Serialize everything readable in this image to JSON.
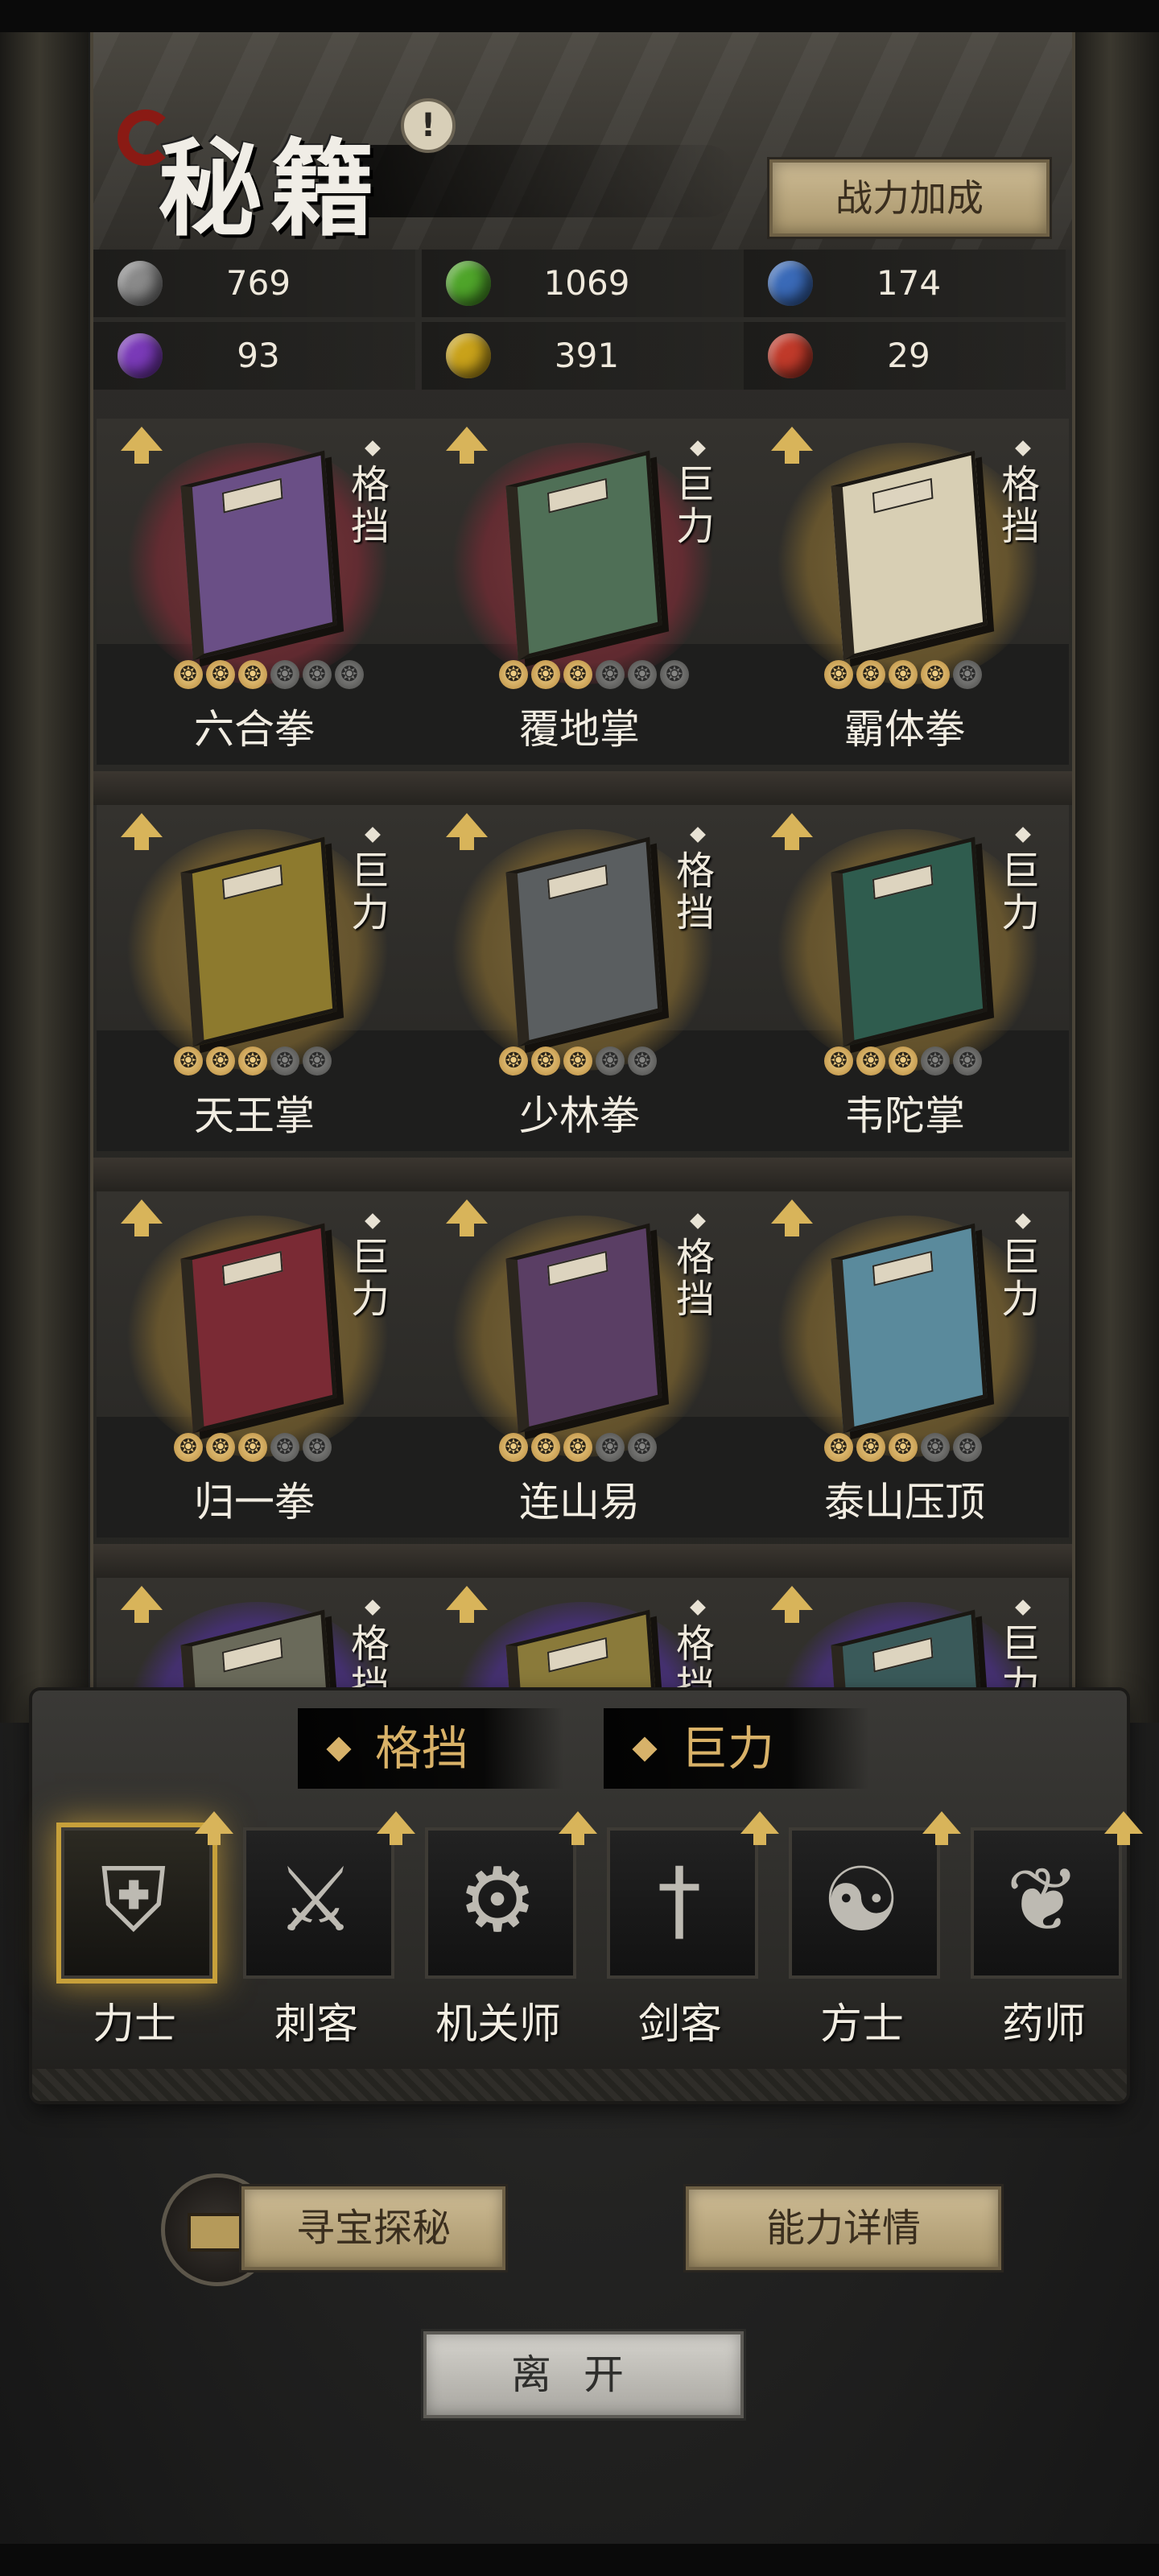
{
  "header": {
    "title": "秘籍",
    "info_icon": "!",
    "bonus_button": "战力加成"
  },
  "resources": [
    {
      "icon": "gray-orb-icon",
      "color": "#8a8a8a",
      "value": "769"
    },
    {
      "icon": "green-orb-icon",
      "color": "#4fa52a",
      "value": "1069"
    },
    {
      "icon": "blue-orb-icon",
      "color": "#3a6ab8",
      "value": "174"
    },
    {
      "icon": "purple-orb-icon",
      "color": "#7a3ab8",
      "value": "93"
    },
    {
      "icon": "yellow-orb-icon",
      "color": "#c9a21a",
      "value": "391"
    },
    {
      "icon": "red-orb-icon",
      "color": "#c03a2a",
      "value": "29"
    }
  ],
  "books": [
    {
      "name": "六合拳",
      "type": "格挡",
      "halo": "red",
      "cover": "#6a4f86",
      "stars_on": 3,
      "stars_total": 6
    },
    {
      "name": "覆地掌",
      "type": "巨力",
      "halo": "red",
      "cover": "#4f6f56",
      "stars_on": 3,
      "stars_total": 6
    },
    {
      "name": "霸体拳",
      "type": "格挡",
      "halo": "gold",
      "cover": "#d8cfb4",
      "stars_on": 4,
      "stars_total": 5
    },
    {
      "name": "天王掌",
      "type": "巨力",
      "halo": "gold",
      "cover": "#8d7a2e",
      "stars_on": 3,
      "stars_total": 5
    },
    {
      "name": "少林拳",
      "type": "格挡",
      "halo": "gold",
      "cover": "#5a5e60",
      "stars_on": 3,
      "stars_total": 5
    },
    {
      "name": "韦陀掌",
      "type": "巨力",
      "halo": "gold",
      "cover": "#2f5c4e",
      "stars_on": 3,
      "stars_total": 5
    },
    {
      "name": "归一拳",
      "type": "巨力",
      "halo": "gold",
      "cover": "#7a2a34",
      "stars_on": 3,
      "stars_total": 5
    },
    {
      "name": "连山易",
      "type": "格挡",
      "halo": "gold",
      "cover": "#5a3e64",
      "stars_on": 3,
      "stars_total": 5
    },
    {
      "name": "泰山压顶",
      "type": "巨力",
      "halo": "gold",
      "cover": "#5a8a9c",
      "stars_on": 3,
      "stars_total": 5
    },
    {
      "name": "",
      "type": "格挡",
      "halo": "purple",
      "cover": "#6a6a5a",
      "stars_on": 0,
      "stars_total": 0
    },
    {
      "name": "",
      "type": "格挡",
      "halo": "purple",
      "cover": "#8a7a3a",
      "stars_on": 0,
      "stars_total": 0
    },
    {
      "name": "",
      "type": "巨力",
      "halo": "purple",
      "cover": "#3a5a5a",
      "stars_on": 0,
      "stars_total": 0
    }
  ],
  "filter_tags": [
    "格挡",
    "巨力"
  ],
  "classes": [
    {
      "name": "力士",
      "icon": "strongman-shield-icon",
      "glyph": "⛨",
      "active": true
    },
    {
      "name": "刺客",
      "icon": "assassin-blade-icon",
      "glyph": "⚔",
      "active": false
    },
    {
      "name": "机关师",
      "icon": "gears-icon",
      "glyph": "⚙",
      "active": false
    },
    {
      "name": "剑客",
      "icon": "sword-icon",
      "glyph": "†",
      "active": false
    },
    {
      "name": "方士",
      "icon": "yin-yang-icon",
      "glyph": "☯",
      "active": false
    },
    {
      "name": "药师",
      "icon": "gourd-icon",
      "glyph": "❦",
      "active": false
    }
  ],
  "buttons": {
    "treasure": "寻宝探秘",
    "ability": "能力详情",
    "leave": "离开"
  }
}
